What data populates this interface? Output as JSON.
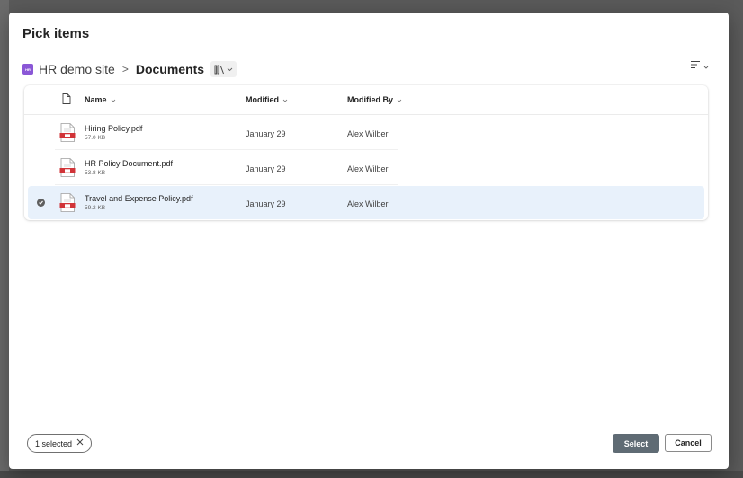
{
  "dialog": {
    "title": "Pick items"
  },
  "breadcrumb": {
    "site_badge": "HR",
    "site_name": "HR demo site",
    "separator": ">",
    "current": "Documents"
  },
  "columns": {
    "name": "Name",
    "modified": "Modified",
    "modified_by": "Modified By"
  },
  "files": [
    {
      "name": "Hiring Policy.pdf",
      "size": "57.0 KB",
      "modified": "January 29",
      "modified_by": "Alex Wilber",
      "selected": false
    },
    {
      "name": "HR Policy Document.pdf",
      "size": "53.8 KB",
      "modified": "January 29",
      "modified_by": "Alex Wilber",
      "selected": false
    },
    {
      "name": "Travel and Expense Policy.pdf",
      "size": "59.2 KB",
      "modified": "January 29",
      "modified_by": "Alex Wilber",
      "selected": true
    }
  ],
  "footer": {
    "selected_count": "1 selected",
    "select_label": "Select",
    "cancel_label": "Cancel"
  },
  "icons": {
    "site": "sharepoint-site-icon",
    "library": "library-icon",
    "view": "view-options-icon",
    "file_type": "document-icon",
    "pdf": "pdf-file-icon",
    "check": "checkmark-circle-icon",
    "close": "close-icon"
  },
  "colors": {
    "site_icon": "#8a57d6",
    "selected_row": "#e8f1fb",
    "select_button": "#5f6b74",
    "pdf_red": "#d13438"
  }
}
